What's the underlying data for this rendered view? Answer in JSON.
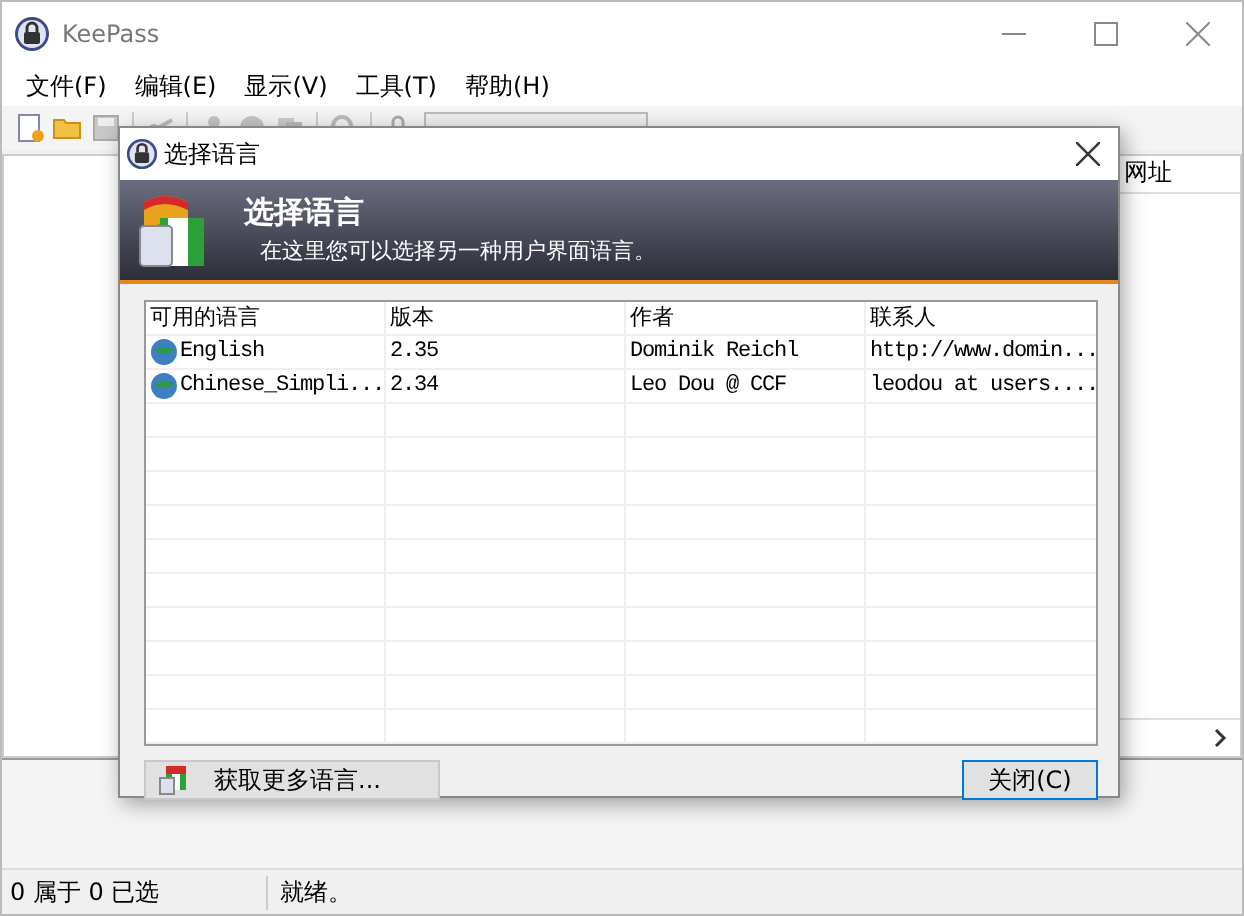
{
  "window": {
    "title": "KeePass"
  },
  "menu": [
    "文件(F)",
    "编辑(E)",
    "显示(V)",
    "工具(T)",
    "帮助(H)"
  ],
  "main_list": {
    "column": "网址"
  },
  "dialog": {
    "title": "选择语言",
    "header_title": "选择语言",
    "header_subtitle": "在这里您可以选择另一种用户界面语言。",
    "columns": [
      "可用的语言",
      "版本",
      "作者",
      "联系人"
    ],
    "rows": [
      {
        "cells": [
          "English",
          "2.35",
          "Dominik Reichl",
          "http://www.domin..."
        ]
      },
      {
        "cells": [
          "Chinese_Simpli...",
          "2.34",
          "Leo Dou @ CCF",
          "leodou at users...."
        ]
      }
    ],
    "more_button": "获取更多语言...",
    "close_button": "关闭(C)"
  },
  "status_bar": [
    "0 属于 0 已选",
    "就绪。"
  ]
}
